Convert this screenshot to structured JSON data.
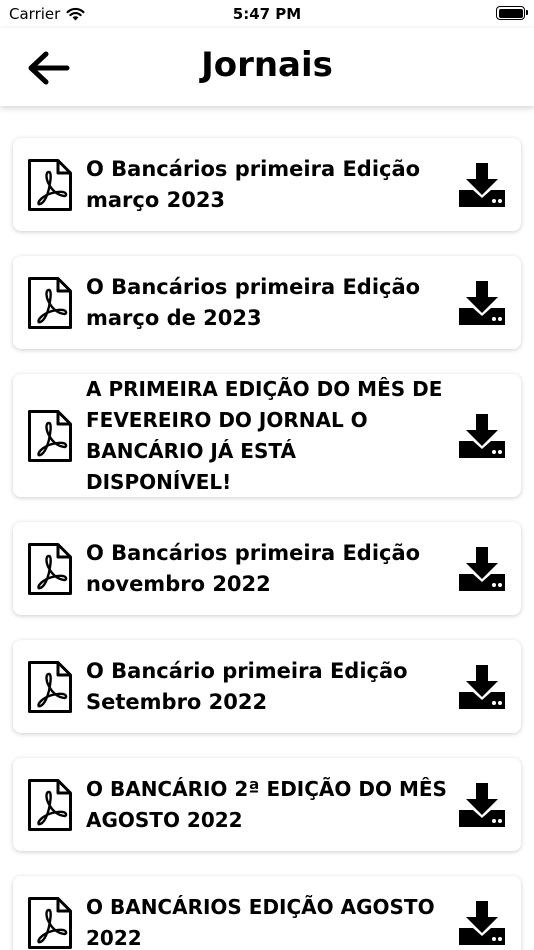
{
  "status": {
    "carrier": "Carrier",
    "time": "5:47 PM"
  },
  "header": {
    "title": "Jornais"
  },
  "documents": [
    {
      "title": "O Bancários primeira Edição março 2023"
    },
    {
      "title": "O Bancários primeira Edição março de 2023"
    },
    {
      "title": "A PRIMEIRA EDIÇÃO DO MÊS DE FEVEREIRO DO JORNAL O BANCÁRIO JÁ ESTÁ DISPONÍVEL!"
    },
    {
      "title": "O Bancários primeira Edição novembro 2022"
    },
    {
      "title": "O Bancário primeira Edição Setembro 2022"
    },
    {
      "title": "O BANCÁRIO 2ª EDIÇÃO DO MÊS AGOSTO 2022"
    },
    {
      "title": "O BANCÁRIOS EDIÇÃO AGOSTO 2022"
    }
  ],
  "icons": {
    "back": "arrow-left-icon",
    "document": "pdf-file-icon",
    "download": "download-icon"
  }
}
